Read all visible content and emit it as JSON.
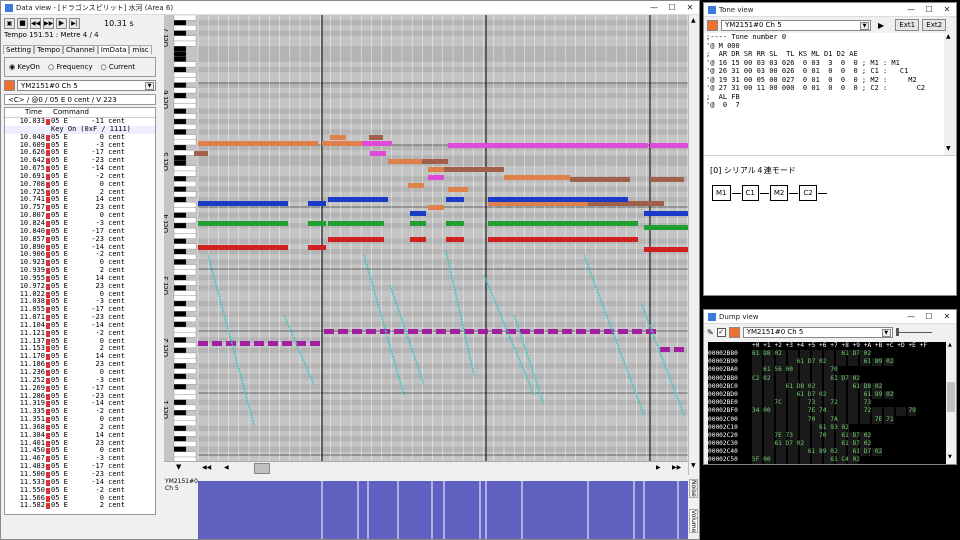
{
  "data_view": {
    "title": "Data view - [ドラゴンスピリット] 水河 (Area 6)",
    "time": "10.31 s",
    "tempo_line": "Tempo 151.51 : Metre 4 / 4",
    "tabs": [
      "Setting",
      "Tempo",
      "Channel",
      "ImData",
      "misc"
    ],
    "radios": [
      "KeyOn",
      "Frequency",
      "Current"
    ],
    "channel": "YM2151#0 Ch 5",
    "info_line": "<C> / @0 / 05 E    0 cent / V 223",
    "col_time": "Time",
    "col_command": "Command",
    "rows": [
      [
        "10.033",
        "05 E",
        "-11 cent"
      ],
      [
        "",
        "Key On",
        "(0xF / 1111)"
      ],
      [
        "10.048",
        "05 E",
        "0 cent"
      ],
      [
        "10.609",
        "05 E",
        "-3 cent"
      ],
      [
        "10.626",
        "05 E",
        "-17 cent"
      ],
      [
        "10.642",
        "05 E",
        "-23 cent"
      ],
      [
        "10.675",
        "05 E",
        "-14 cent"
      ],
      [
        "10.691",
        "05 E",
        "-2 cent"
      ],
      [
        "10.708",
        "05 E",
        "0 cent"
      ],
      [
        "10.725",
        "05 E",
        "2 cent"
      ],
      [
        "10.741",
        "05 E",
        "14 cent"
      ],
      [
        "10.757",
        "05 E",
        "23 cent"
      ],
      [
        "10.807",
        "05 E",
        "0 cent"
      ],
      [
        "10.824",
        "05 E",
        "-3 cent"
      ],
      [
        "10.840",
        "05 E",
        "-17 cent"
      ],
      [
        "10.857",
        "05 E",
        "-23 cent"
      ],
      [
        "10.890",
        "05 E",
        "-14 cent"
      ],
      [
        "10.906",
        "05 E",
        "-2 cent"
      ],
      [
        "10.923",
        "05 E",
        "0 cent"
      ],
      [
        "10.939",
        "05 E",
        "2 cent"
      ],
      [
        "10.955",
        "05 E",
        "14 cent"
      ],
      [
        "10.972",
        "05 E",
        "23 cent"
      ],
      [
        "11.022",
        "05 E",
        "0 cent"
      ],
      [
        "11.038",
        "05 E",
        "-3 cent"
      ],
      [
        "11.055",
        "05 E",
        "-17 cent"
      ],
      [
        "11.071",
        "05 E",
        "-23 cent"
      ],
      [
        "11.104",
        "05 E",
        "-14 cent"
      ],
      [
        "11.121",
        "05 E",
        "-2 cent"
      ],
      [
        "11.137",
        "05 E",
        "0 cent"
      ],
      [
        "11.153",
        "05 E",
        "2 cent"
      ],
      [
        "11.170",
        "05 E",
        "14 cent"
      ],
      [
        "11.186",
        "05 E",
        "23 cent"
      ],
      [
        "11.236",
        "05 E",
        "0 cent"
      ],
      [
        "11.252",
        "05 E",
        "-3 cent"
      ],
      [
        "11.269",
        "05 E",
        "-17 cent"
      ],
      [
        "11.286",
        "05 E",
        "-23 cent"
      ],
      [
        "11.319",
        "05 E",
        "-14 cent"
      ],
      [
        "11.335",
        "05 E",
        "-2 cent"
      ],
      [
        "11.351",
        "05 E",
        "0 cent"
      ],
      [
        "11.368",
        "05 E",
        "2 cent"
      ],
      [
        "11.384",
        "05 E",
        "14 cent"
      ],
      [
        "11.401",
        "05 E",
        "23 cent"
      ],
      [
        "11.450",
        "05 E",
        "0 cent"
      ],
      [
        "11.467",
        "05 E",
        "-3 cent"
      ],
      [
        "11.483",
        "05 E",
        "-17 cent"
      ],
      [
        "11.500",
        "05 E",
        "-23 cent"
      ],
      [
        "11.533",
        "05 E",
        "-14 cent"
      ],
      [
        "11.550",
        "05 E",
        "-2 cent"
      ],
      [
        "11.566",
        "05 E",
        "0 cent"
      ],
      [
        "11.582",
        "05 E",
        "2 cent"
      ]
    ],
    "octave_labels": [
      "Oct 7",
      "Oct 6",
      "Oct 5",
      "Oct 4",
      "Oct 3",
      "Oct 2",
      "Oct 1",
      "Oct 0"
    ],
    "vol_channel": "YM2151#0\nCh 5",
    "side_tabs": [
      "Noise",
      "Volume"
    ],
    "colors": {
      "orange": "#e0804a",
      "pink": "#e04ad8",
      "brown": "#a0604a",
      "blue": "#1a3ac8",
      "green": "#20a030",
      "red": "#d02020",
      "purple": "#a020a0",
      "cyan": "#40c8c8",
      "volume": "#6060c0"
    }
  },
  "tone_view": {
    "title": "Tone view",
    "channel": "YM2151#0 Ch 5",
    "ext1": "Ext1",
    "ext2": "Ext2",
    "lines": [
      ";---- Tone number 0",
      "'@ M 000",
      ";  AR DR SR RR SL  TL KS ML D1 D2 AE",
      "'@ 16 15 00 03 03 026  0 03  3  0  0 ; M1 : M1",
      "'@ 26 31 00 03 00 026  0 01  0  0  0 ; C1 :   C1",
      "'@ 19 31 00 05 00 027  0 01  0  0  0 ; M2 :     M2",
      "'@ 27 31 00 11 00 000  0 01  0  0  0 ; C2 :       C2",
      ";  AL FB",
      "'@  0  7"
    ],
    "mode": "[0] シリアル４連モード",
    "blocks": [
      "M1",
      "C1",
      "M2",
      "C2"
    ]
  },
  "dump_view": {
    "title": "Dump view",
    "channel": "YM2151#0 Ch 5",
    "header": "+0 +1 +2 +3 +4 +5 +6 +7 +8 +9 +A +B +C +D +E +F",
    "addresses": [
      "00002B80",
      "00002B90",
      "00002BA0",
      "00002BB0",
      "00002BC0",
      "00002BD0",
      "00002BE0",
      "00002BF0",
      "00002C00",
      "00002C10",
      "00002C20",
      "00002C30",
      "00002C40",
      "00002C50"
    ],
    "hex_rows": [
      "61 D8 02                61 D7 02",
      "            61 D7 02          61 89 02",
      "   61 56 00          70",
      "C2 02                61 D7 02",
      "         61 D8 02          61 D8 02",
      "            61 D7 02          61 89 02",
      "      7C       73    72       73",
      "34 00          7E 74          72          79",
      "               70    7A          7E 71",
      "                  61 93 02",
      "      7E 73       70    61 D7 02",
      "      61 D7 02          61 D7 02",
      "               61 89 02    61 D7 02",
      "5F 00                61 C4 02"
    ]
  }
}
